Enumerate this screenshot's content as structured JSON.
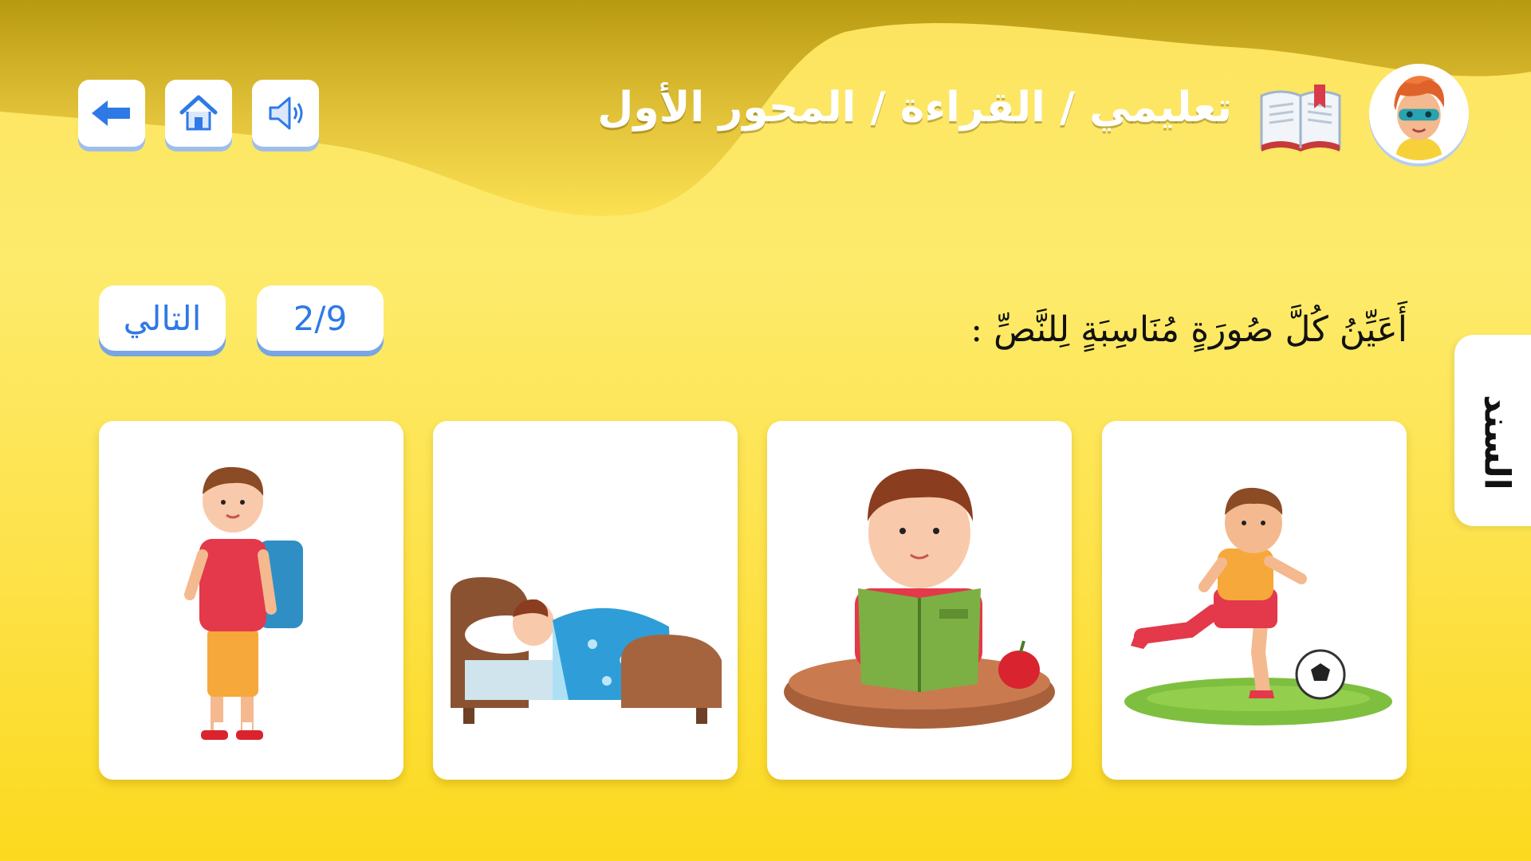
{
  "header": {
    "breadcrumb": "تعليمي / القراءة / المحور الأول",
    "icons": [
      "avatar-boy",
      "book-icon",
      "sound-icon",
      "home-icon",
      "back-arrow-icon"
    ]
  },
  "exercise": {
    "instruction": "أَعَيِّنُ كُلَّ صُورَةٍ مُنَاسِبَةٍ لِلنَّصِّ :",
    "progress": "2/9",
    "next_label": "التالي",
    "side_tab_label": "السند"
  },
  "cards": [
    {
      "image": "boy-playing-football"
    },
    {
      "image": "boy-reading-book"
    },
    {
      "image": "boy-sleeping-in-bed"
    },
    {
      "image": "boy-with-school-backpack"
    }
  ],
  "colors": {
    "background": "#fde24a",
    "accent_blue": "#2f79e6",
    "button_shadow": "#7aa4e4",
    "card": "#ffffff"
  }
}
